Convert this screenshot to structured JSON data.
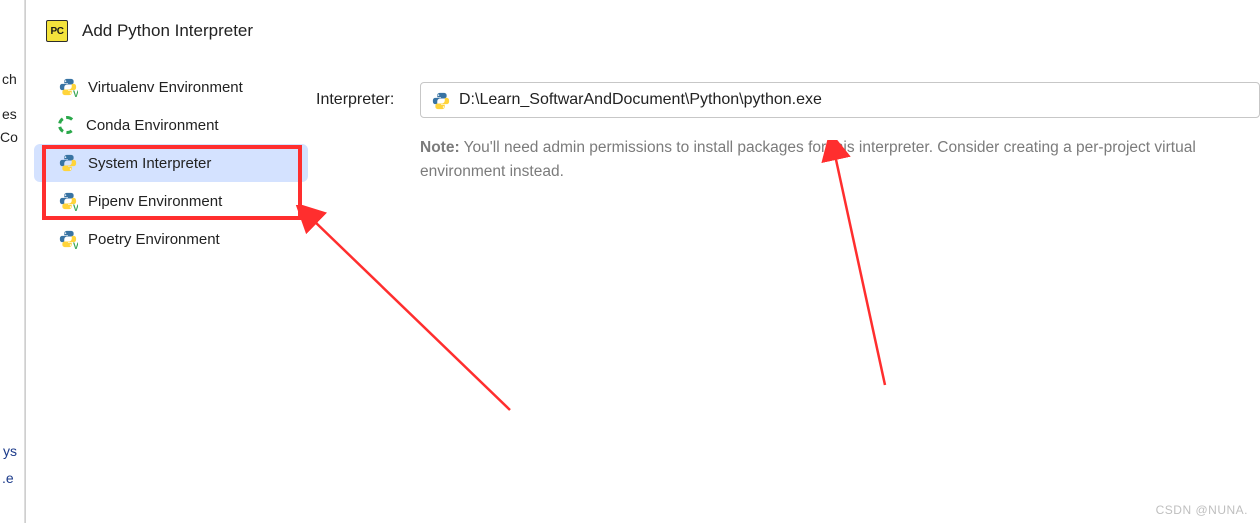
{
  "dialog": {
    "title": "Add Python Interpreter",
    "app_icon_text": "PC"
  },
  "sidebar": {
    "items": [
      {
        "label": "Virtualenv Environment",
        "icon": "python-v-icon",
        "selected": false
      },
      {
        "label": "Conda Environment",
        "icon": "conda-icon",
        "selected": false
      },
      {
        "label": "System Interpreter",
        "icon": "python-icon",
        "selected": true
      },
      {
        "label": "Pipenv Environment",
        "icon": "python-v-icon",
        "selected": false
      },
      {
        "label": "Poetry Environment",
        "icon": "python-v-icon",
        "selected": false
      }
    ]
  },
  "form": {
    "interpreter_label": "Interpreter:",
    "interpreter_value": "D:\\Learn_SoftwarAndDocument\\Python\\python.exe"
  },
  "note": {
    "prefix": "Note:",
    "text": "You'll need admin permissions to install packages for this interpreter. Consider creating a per-project virtual environment instead."
  },
  "annotations": {
    "arrow_color": "#ff2e2e"
  },
  "obscured": {
    "frag1": "ch",
    "frag2": "es",
    "frag3": "Co",
    "frag4": "ys",
    "frag5": ".e"
  },
  "watermark": "CSDN @NUNA."
}
